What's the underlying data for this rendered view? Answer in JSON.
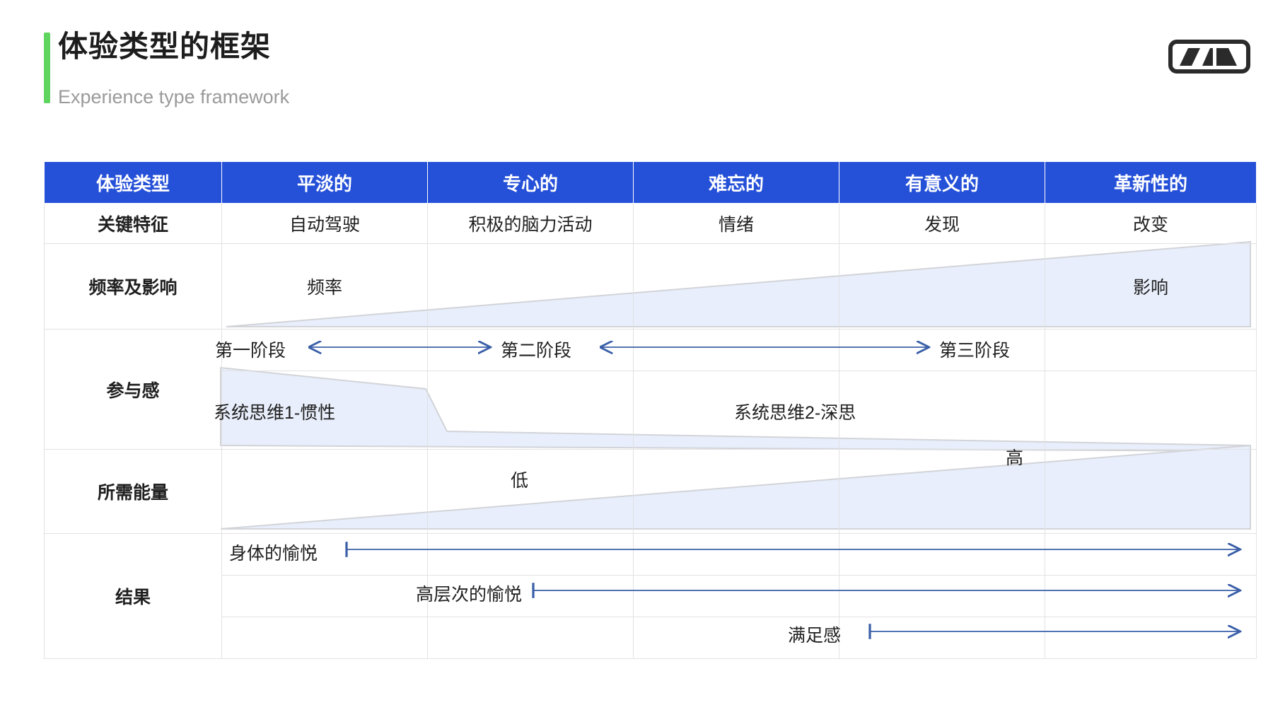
{
  "header": {
    "title_cn": "体验类型的框架",
    "title_en": "Experience type framework",
    "accent_color": "#5fd45f",
    "logo_name": "brand-logo"
  },
  "theme": {
    "header_blue": "#2550d8",
    "wedge_fill": "#e8eefb",
    "wedge_stroke": "#d2d4d8",
    "arrow_blue": "#3a5fa8",
    "grid_line": "#e2e2e4"
  },
  "table": {
    "columns": [
      "体验类型",
      "平淡的",
      "专心的",
      "难忘的",
      "有意义的",
      "革新性的"
    ],
    "rows": [
      {
        "label": "关键特征",
        "cells": [
          "自动驾驶",
          "积极的脑力活动",
          "情绪",
          "发现",
          "改变"
        ]
      },
      {
        "label": "频率及影响",
        "cells": [
          "频率",
          "",
          "",
          "",
          "影响"
        ]
      },
      {
        "label": "参与感",
        "stage_labels": [
          "第一阶段",
          "第二阶段",
          "第三阶段"
        ],
        "system_labels": [
          "系统思维1-惯性",
          "系统思维2-深思"
        ]
      },
      {
        "label": "所需能量",
        "low_label": "低",
        "high_label": "高"
      },
      {
        "label": "结果",
        "outcomes": [
          "身体的愉悦",
          "高层次的愉悦",
          "满足感"
        ]
      }
    ]
  },
  "chart_data": {
    "type": "table",
    "title": "体验类型的框架",
    "subtitle": "Experience type framework",
    "categories": [
      "平淡的",
      "专心的",
      "难忘的",
      "有意义的",
      "革新性的"
    ],
    "rows": [
      {
        "name": "关键特征",
        "values": [
          "自动驾驶",
          "积极的脑力活动",
          "情绪",
          "发现",
          "改变"
        ]
      },
      {
        "name": "频率及影响",
        "values": [
          "频率",
          "",
          "",
          "",
          "影响"
        ]
      },
      {
        "name": "参与感",
        "values": [
          "第一阶段 / 系统思维1-惯性",
          "",
          "第二阶段",
          "系统思维2-深思",
          "第三阶段"
        ]
      },
      {
        "name": "所需能量",
        "values": [
          "",
          "低",
          "",
          "",
          "高"
        ]
      },
      {
        "name": "结果",
        "values": [
          "身体的愉悦",
          "高层次的愉悦",
          "",
          "满足感",
          ""
        ]
      }
    ],
    "annotations": [
      {
        "text": "频率→影响 递增楔形",
        "from": "平淡的",
        "to": "革新性的"
      },
      {
        "text": "系统思维 惯性→深思 递减带",
        "from": "平淡的",
        "to": "革新性的"
      },
      {
        "text": "所需能量 低→高 递增楔形",
        "from": "平淡的",
        "to": "革新性的"
      }
    ]
  }
}
